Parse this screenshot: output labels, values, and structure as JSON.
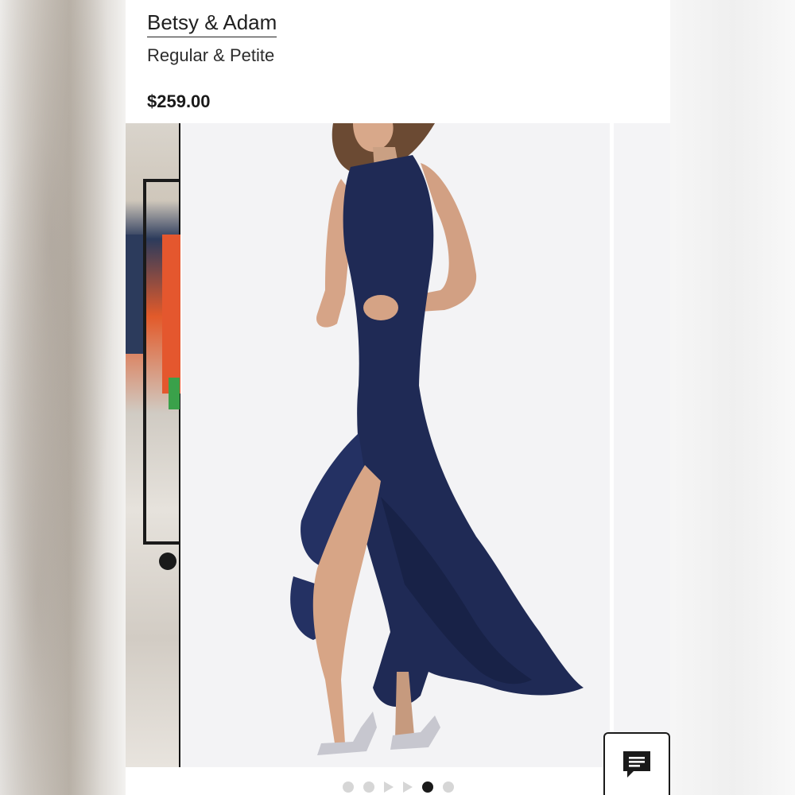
{
  "product": {
    "brand": "Betsy & Adam",
    "size_range": "Regular & Petite",
    "price": "$259.00"
  },
  "gallery": {
    "slides": [
      {
        "kind": "image",
        "active": false
      },
      {
        "kind": "image",
        "active": false
      },
      {
        "kind": "video",
        "active": false
      },
      {
        "kind": "video",
        "active": false
      },
      {
        "kind": "image",
        "active": true
      },
      {
        "kind": "image",
        "active": false
      }
    ]
  },
  "chat": {
    "icon": "chat-icon"
  },
  "colors": {
    "dress": "#1f2a55",
    "dot_active": "#1a1a1a",
    "dot_inactive": "#d6d6d6"
  }
}
